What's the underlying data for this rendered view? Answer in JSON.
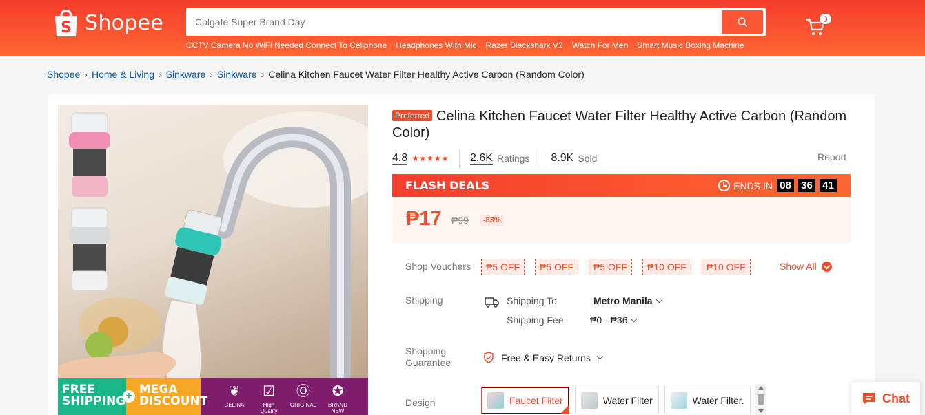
{
  "header": {
    "logo_text": "Shopee",
    "search": {
      "value": "",
      "placeholder": "Colgate Super Brand Day"
    },
    "suggestions": [
      "CCTV Camera No WiFi Needed Connect To Cellphone",
      "Headphones With Mic",
      "Razer Blackshark V2",
      "Watch For Men",
      "Smart Music Boxing Machine"
    ],
    "cart_count": "3",
    "brand_color": "#ee4d2d"
  },
  "breadcrumb": {
    "items": [
      "Shopee",
      "Home & Living",
      "Sinkware",
      "Sinkware"
    ],
    "current": "Celina Kitchen Faucet Water Filter Healthy Active Carbon (Random Color)"
  },
  "promo": {
    "free": "FREE",
    "shipping": "SHIPPING",
    "mega": "MEGA",
    "discount": "DISCOUNT",
    "badges": [
      "CELINA",
      "High Quality",
      "ORIGINAL",
      "BRAND NEW"
    ]
  },
  "product": {
    "preferred_label": "Preferred",
    "title": "Celina Kitchen Faucet Water Filter Healthy Active Carbon (Random Color)",
    "rating": "4.8",
    "rating_stars": 5,
    "ratings_count": "2.6K",
    "ratings_label": "Ratings",
    "sold_count": "8.9K",
    "sold_label": "Sold",
    "report_label": "Report"
  },
  "flash": {
    "title": "FLASH DEALS",
    "ends_label": "ENDS IN",
    "hours": "08",
    "minutes": "36",
    "seconds": "41",
    "price": "₱17",
    "old_price": "₱99",
    "discount": "-83%"
  },
  "vouchers": {
    "label": "Shop Vouchers",
    "items": [
      "₱5 OFF",
      "₱5 OFF",
      "₱5 OFF",
      "₱10 OFF",
      "₱10 OFF"
    ],
    "show_all": "Show All"
  },
  "shipping": {
    "label": "Shipping",
    "to_label": "Shipping To",
    "to_value": "Metro Manila",
    "fee_label": "Shipping Fee",
    "fee_value": "₱0 - ₱36"
  },
  "guarantee": {
    "label_line1": "Shopping",
    "label_line2": "Guarantee",
    "value": "Free & Easy Returns"
  },
  "design": {
    "label": "Design",
    "options": [
      "Faucet Filter",
      "Water Filter",
      "Water Filter."
    ],
    "selected_index": 0
  },
  "chat": {
    "label": "Chat"
  }
}
